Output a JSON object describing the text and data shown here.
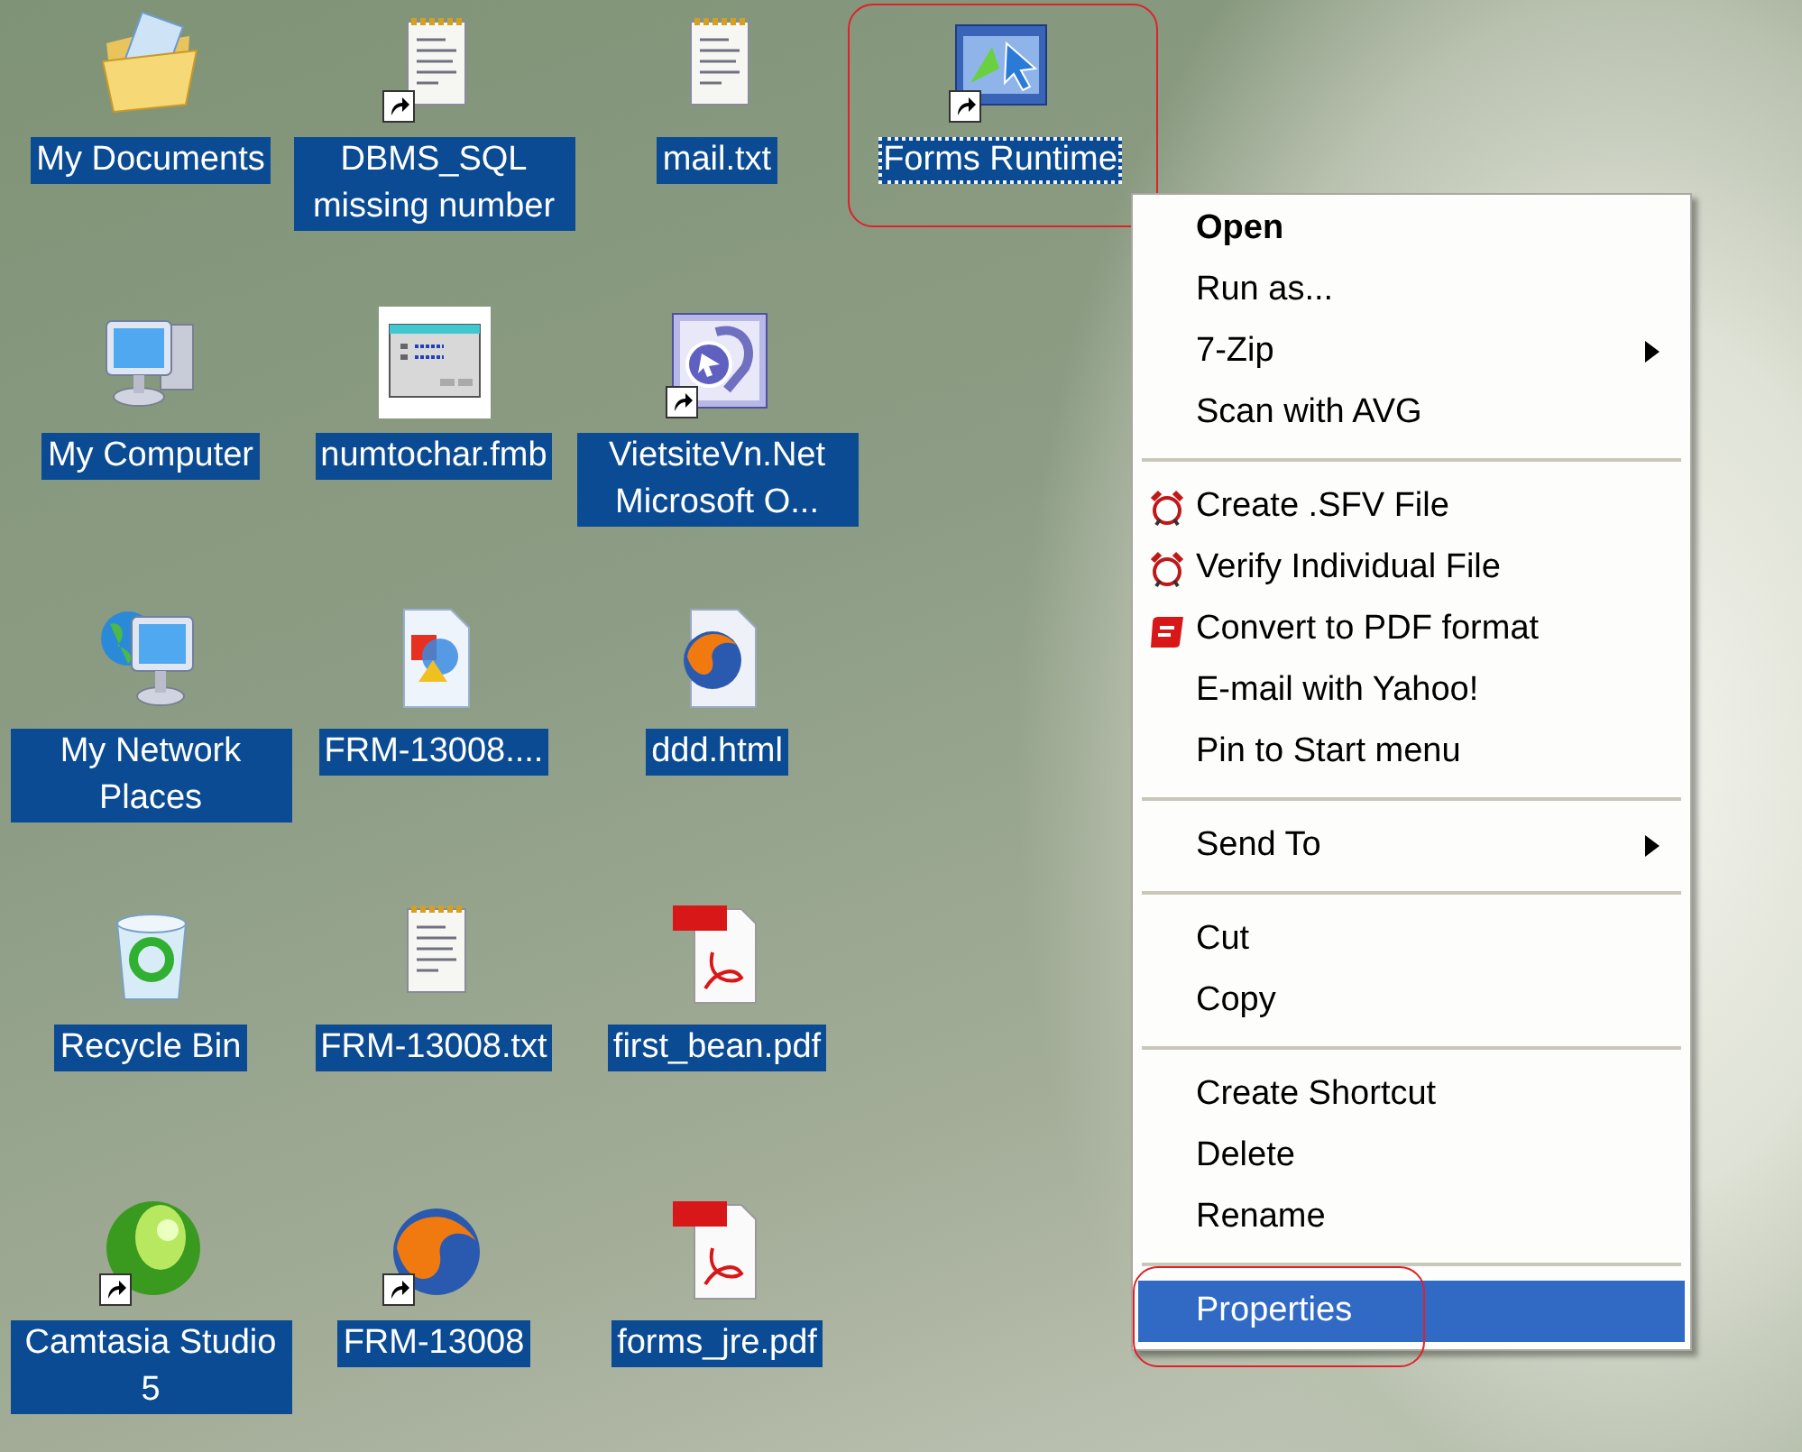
{
  "desktop": {
    "rows": [
      [
        {
          "kind": "documents-folder",
          "label": "My Documents",
          "shortcut": false,
          "selected": true,
          "focused": false,
          "annotated": false
        },
        {
          "kind": "notepad",
          "label": "DBMS_SQL missing number",
          "shortcut": true,
          "selected": true,
          "focused": false,
          "annotated": false
        },
        {
          "kind": "notepad",
          "label": "mail.txt",
          "shortcut": false,
          "selected": true,
          "focused": false,
          "annotated": false
        },
        {
          "kind": "forms-runtime",
          "label": "Forms Runtime",
          "shortcut": true,
          "selected": true,
          "focused": true,
          "annotated": true
        }
      ],
      [
        {
          "kind": "computer",
          "label": "My Computer",
          "shortcut": false,
          "selected": true,
          "focused": false,
          "annotated": false
        },
        {
          "kind": "form-window",
          "label": "numtochar.fmb",
          "shortcut": false,
          "selected": true,
          "focused": false,
          "annotated": false
        },
        {
          "kind": "app",
          "label": "VietsiteVn.Net Microsoft O...",
          "shortcut": true,
          "selected": true,
          "focused": false,
          "annotated": false
        }
      ],
      [
        {
          "kind": "network",
          "label": "My Network Places",
          "shortcut": false,
          "selected": true,
          "focused": false,
          "annotated": false
        },
        {
          "kind": "shapes-document",
          "label": "FRM-13008....",
          "shortcut": false,
          "selected": true,
          "focused": false,
          "annotated": false
        },
        {
          "kind": "browser-document",
          "label": "ddd.html",
          "shortcut": false,
          "selected": true,
          "focused": false,
          "annotated": false
        }
      ],
      [
        {
          "kind": "recycle-bin",
          "label": "Recycle Bin",
          "shortcut": false,
          "selected": true,
          "focused": false,
          "annotated": false
        },
        {
          "kind": "notepad",
          "label": "FRM-13008.txt",
          "shortcut": false,
          "selected": true,
          "focused": false,
          "annotated": false
        },
        {
          "kind": "pdf",
          "label": "first_bean.pdf",
          "shortcut": false,
          "selected": true,
          "focused": false,
          "annotated": false
        }
      ],
      [
        {
          "kind": "camtasia",
          "label": "Camtasia Studio 5",
          "shortcut": true,
          "selected": true,
          "focused": false,
          "annotated": false
        },
        {
          "kind": "browser",
          "label": "FRM-13008",
          "shortcut": true,
          "selected": true,
          "focused": false,
          "annotated": false
        },
        {
          "kind": "pdf",
          "label": "forms_jre.pdf",
          "shortcut": false,
          "selected": true,
          "focused": false,
          "annotated": false
        }
      ]
    ]
  },
  "context_menu": {
    "sections": [
      [
        {
          "kind": "plain",
          "label": "Open",
          "bold": true,
          "submenu": false,
          "selected": false,
          "annotated": false
        },
        {
          "kind": "plain",
          "label": "Run as...",
          "bold": false,
          "submenu": false,
          "selected": false,
          "annotated": false
        },
        {
          "kind": "plain",
          "label": "7-Zip",
          "bold": false,
          "submenu": true,
          "selected": false,
          "annotated": false
        },
        {
          "kind": "plain",
          "label": "Scan with AVG",
          "bold": false,
          "submenu": false,
          "selected": false,
          "annotated": false
        }
      ],
      [
        {
          "kind": "checksum",
          "label": "Create .SFV File",
          "bold": false,
          "submenu": false,
          "selected": false,
          "annotated": false
        },
        {
          "kind": "checksum",
          "label": "Verify Individual File",
          "bold": false,
          "submenu": false,
          "selected": false,
          "annotated": false
        },
        {
          "kind": "pdf",
          "label": "Convert to PDF format",
          "bold": false,
          "submenu": false,
          "selected": false,
          "annotated": false
        },
        {
          "kind": "plain",
          "label": "E-mail with Yahoo!",
          "bold": false,
          "submenu": false,
          "selected": false,
          "annotated": false
        },
        {
          "kind": "plain",
          "label": "Pin to Start menu",
          "bold": false,
          "submenu": false,
          "selected": false,
          "annotated": false
        }
      ],
      [
        {
          "kind": "plain",
          "label": "Send To",
          "bold": false,
          "submenu": true,
          "selected": false,
          "annotated": false
        }
      ],
      [
        {
          "kind": "plain",
          "label": "Cut",
          "bold": false,
          "submenu": false,
          "selected": false,
          "annotated": false
        },
        {
          "kind": "plain",
          "label": "Copy",
          "bold": false,
          "submenu": false,
          "selected": false,
          "annotated": false
        }
      ],
      [
        {
          "kind": "plain",
          "label": "Create Shortcut",
          "bold": false,
          "submenu": false,
          "selected": false,
          "annotated": false
        },
        {
          "kind": "plain",
          "label": "Delete",
          "bold": false,
          "submenu": false,
          "selected": false,
          "annotated": false
        },
        {
          "kind": "plain",
          "label": "Rename",
          "bold": false,
          "submenu": false,
          "selected": false,
          "annotated": false
        }
      ],
      [
        {
          "kind": "plain",
          "label": "Properties",
          "bold": false,
          "submenu": false,
          "selected": true,
          "annotated": true
        }
      ]
    ]
  }
}
